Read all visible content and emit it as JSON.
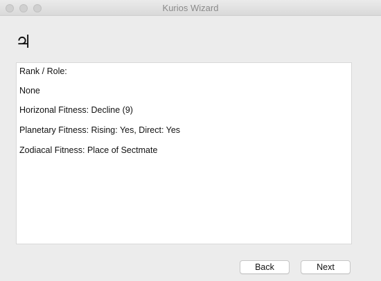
{
  "window": {
    "title": "Kurios Wizard"
  },
  "header": {
    "planet_glyph": "♃",
    "planet_icon": "jupiter-icon"
  },
  "content": {
    "lines": [
      "Rank / Role:",
      "None",
      "Horizonal Fitness: Decline (9)",
      "Planetary Fitness: Rising: Yes, Direct: Yes",
      "Zodiacal Fitness: Place of Sectmate"
    ]
  },
  "buttons": {
    "back_label": "Back",
    "next_label": "Next"
  }
}
